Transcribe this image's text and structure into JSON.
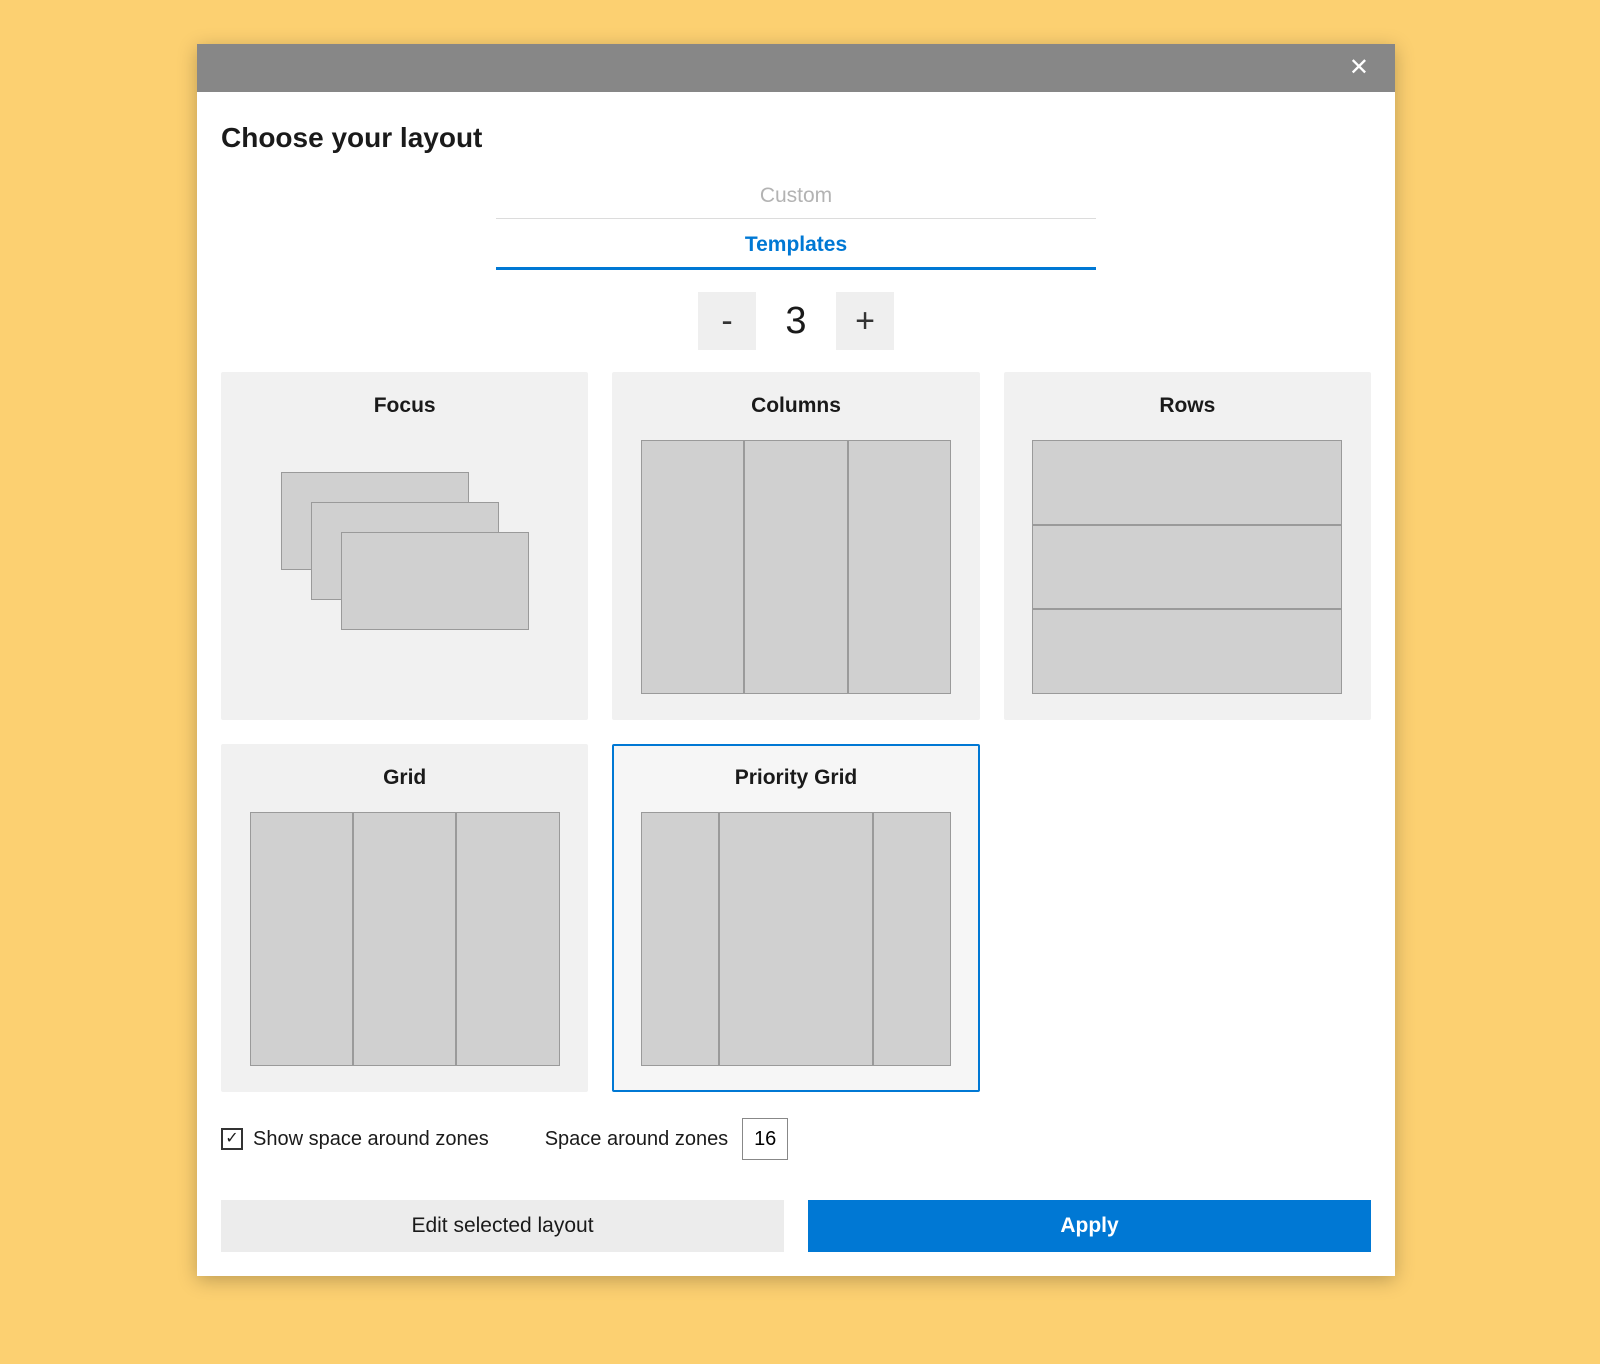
{
  "dialog": {
    "title": "Choose your layout"
  },
  "tabs": {
    "custom": "Custom",
    "templates": "Templates",
    "active": "templates"
  },
  "stepper": {
    "minus": "-",
    "plus": "+",
    "value": "3"
  },
  "templates": {
    "focus": "Focus",
    "columns": "Columns",
    "rows": "Rows",
    "grid": "Grid",
    "priority_grid": "Priority Grid",
    "selected": "priority_grid"
  },
  "options": {
    "show_space_label": "Show space around zones",
    "show_space_checked": true,
    "space_label": "Space around zones",
    "space_value": "16"
  },
  "buttons": {
    "edit": "Edit selected layout",
    "apply": "Apply"
  }
}
